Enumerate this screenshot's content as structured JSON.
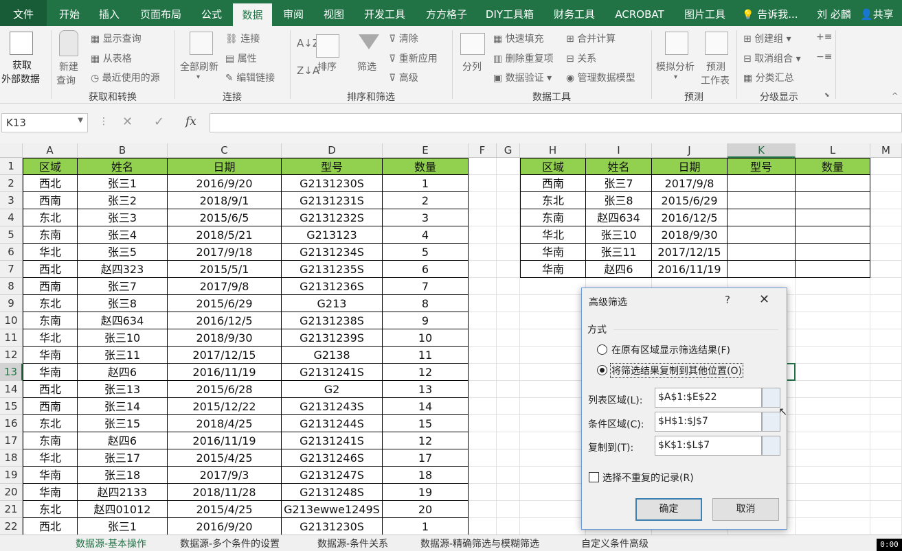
{
  "tabs": [
    "文件",
    "开始",
    "插入",
    "页面布局",
    "公式",
    "数据",
    "审阅",
    "视图",
    "开发工具",
    "方方格子",
    "DIY工具箱",
    "财务工具",
    "ACROBAT",
    "图片工具"
  ],
  "search": "告诉我...",
  "user": "刘 必麟",
  "share": "共享",
  "ribbon": {
    "get_data": [
      "获取",
      "外部数据"
    ],
    "new_query": [
      "新建",
      "查询"
    ],
    "show_query": "显示查询",
    "from_table": "从表格",
    "recent_sources": "最近使用的源",
    "refresh_all": "全部刷新",
    "connections": "连接",
    "properties": "属性",
    "edit_links": "编辑链接",
    "sort": "排序",
    "filter": "筛选",
    "clear": "清除",
    "reapply": "重新应用",
    "advanced": "高级",
    "split": "分列",
    "flash_fill": "快速填充",
    "remove_dup": "删除重复项",
    "validation": "数据验证",
    "consolidate": "合并计算",
    "relationships": "关系",
    "data_model": "管理数据模型",
    "what_if": "模拟分析",
    "forecast": [
      "预测",
      "工作表"
    ],
    "group": "创建组",
    "ungroup": "取消组合",
    "subtotal": "分类汇总",
    "groups": [
      "获取和转换",
      "连接",
      "排序和筛选",
      "数据工具",
      "预测",
      "分级显示"
    ]
  },
  "namebox": "K13",
  "fx": "fx",
  "columns": [
    "A",
    "B",
    "C",
    "D",
    "E",
    "F",
    "G",
    "H",
    "I",
    "J",
    "K",
    "L",
    "M"
  ],
  "rows": [
    "1",
    "2",
    "3",
    "4",
    "5",
    "6",
    "7",
    "8",
    "9",
    "10",
    "11",
    "12",
    "13",
    "14",
    "15",
    "16",
    "17",
    "18",
    "19",
    "20",
    "21",
    "22"
  ],
  "main_table": {
    "headers": [
      "区域",
      "姓名",
      "日期",
      "型号",
      "数量"
    ],
    "rows": [
      [
        "西北",
        "张三1",
        "2016/9/20",
        "G2131230S",
        "1"
      ],
      [
        "西南",
        "张三2",
        "2018/9/1",
        "G2131231S",
        "2"
      ],
      [
        "东北",
        "张三3",
        "2015/6/5",
        "G2131232S",
        "3"
      ],
      [
        "东南",
        "张三4",
        "2018/5/21",
        "G213123",
        "4"
      ],
      [
        "华北",
        "张三5",
        "2017/9/18",
        "G2131234S",
        "5"
      ],
      [
        "西北",
        "赵四323",
        "2015/5/1",
        "G2131235S",
        "6"
      ],
      [
        "西南",
        "张三7",
        "2017/9/8",
        "G2131236S",
        "7"
      ],
      [
        "东北",
        "张三8",
        "2015/6/29",
        "G213",
        "8"
      ],
      [
        "东南",
        "赵四634",
        "2016/12/5",
        "G2131238S",
        "9"
      ],
      [
        "华北",
        "张三10",
        "2018/9/30",
        "G2131239S",
        "10"
      ],
      [
        "华南",
        "张三11",
        "2017/12/15",
        "G2138",
        "11"
      ],
      [
        "华南",
        "赵四6",
        "2016/11/19",
        "G2131241S",
        "12"
      ],
      [
        "西北",
        "张三13",
        "2015/6/28",
        "G2",
        "13"
      ],
      [
        "西南",
        "张三14",
        "2015/12/22",
        "G2131243S",
        "14"
      ],
      [
        "东北",
        "张三15",
        "2018/4/25",
        "G2131244S",
        "15"
      ],
      [
        "东南",
        "赵四6",
        "2016/11/19",
        "G2131241S",
        "12"
      ],
      [
        "华北",
        "张三17",
        "2015/4/25",
        "G2131246S",
        "17"
      ],
      [
        "华南",
        "张三18",
        "2017/9/3",
        "G2131247S",
        "18"
      ],
      [
        "华南",
        "赵四2133",
        "2018/11/28",
        "G2131248S",
        "19"
      ],
      [
        "东北",
        "赵四01012",
        "2015/4/25",
        "G213ewwe1249S",
        "20"
      ],
      [
        "西北",
        "张三1",
        "2016/9/20",
        "G2131230S",
        "1"
      ]
    ]
  },
  "criteria_table": {
    "headers": [
      "区域",
      "姓名",
      "日期",
      "型号",
      "数量"
    ],
    "rows": [
      [
        "西南",
        "张三7",
        "2017/9/8",
        "",
        ""
      ],
      [
        "东北",
        "张三8",
        "2015/6/29",
        "",
        ""
      ],
      [
        "东南",
        "赵四634",
        "2016/12/5",
        "",
        ""
      ],
      [
        "华北",
        "张三10",
        "2018/9/30",
        "",
        ""
      ],
      [
        "华南",
        "张三11",
        "2017/12/15",
        "",
        ""
      ],
      [
        "华南",
        "赵四6",
        "2016/11/19",
        "",
        ""
      ]
    ]
  },
  "dialog": {
    "title": "高级筛选",
    "help": "?",
    "close": "✕",
    "group_label": "方式",
    "option1": "在原有区域显示筛选结果(F)",
    "option2": "将筛选结果复制到其他位置(O)",
    "list_label": "列表区域(L):",
    "list_value": "$A$1:$E$22",
    "criteria_label": "条件区域(C):",
    "criteria_value": "$H$1:$J$7",
    "copyto_label": "复制到(T):",
    "copyto_value": "$K$1:$L$7",
    "unique_label": "选择不重复的记录(R)",
    "ok": "确定",
    "cancel": "取消"
  },
  "sheets": [
    "数据源-基本操作",
    "数据源-多个条件的设置",
    "数据源-条件关系",
    "数据源-精确筛选与模糊筛选",
    "自定义条件高级"
  ],
  "timer": "0:00"
}
